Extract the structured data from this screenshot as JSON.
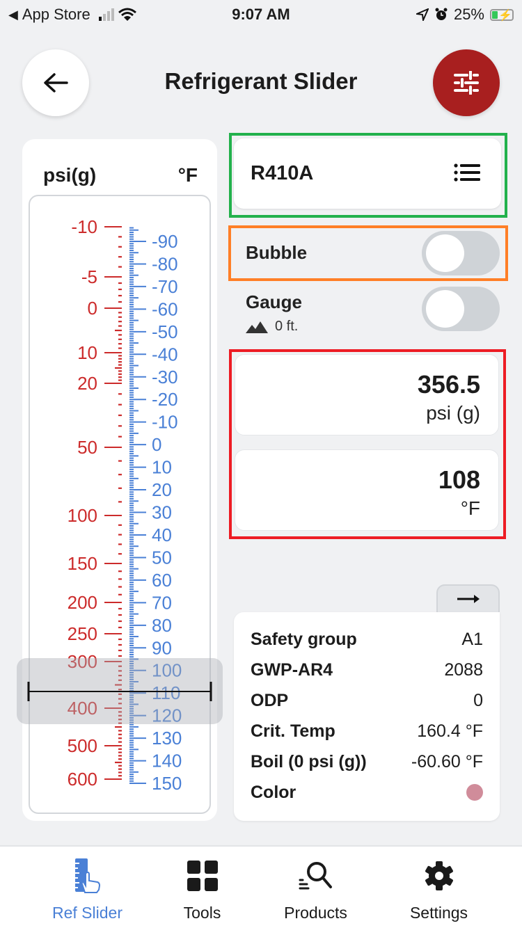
{
  "status_bar": {
    "back_app": "App Store",
    "time": "9:07 AM",
    "battery": "25%",
    "battery_level": 0.25
  },
  "header": {
    "title": "Refrigerant Slider",
    "back_icon": "arrow-left-icon",
    "filter_icon": "sliders-icon",
    "accent_color": "#a81f1f"
  },
  "scale": {
    "left_unit": "psi(g)",
    "right_unit": "°F",
    "pressure_color": "#cc2b2b",
    "temperature_color": "#4a80d6",
    "pressure_labels": [
      "-10",
      "-5",
      "0",
      "10",
      "20",
      "50",
      "100",
      "150",
      "200",
      "250",
      "300",
      "400",
      "500",
      "600"
    ],
    "temperature_labels": [
      "-90",
      "-80",
      "-70",
      "-60",
      "-50",
      "-40",
      "-30",
      "-20",
      "-10",
      "0",
      "10",
      "20",
      "30",
      "40",
      "50",
      "60",
      "70",
      "80",
      "90",
      "100",
      "110",
      "120",
      "130",
      "140",
      "150"
    ],
    "slider_temperature": 108
  },
  "refrigerant": {
    "name": "R410A",
    "list_icon": "list-icon"
  },
  "toggles": {
    "bubble_label": "Bubble",
    "bubble_on": false,
    "gauge_label": "Gauge",
    "gauge_on": false,
    "altitude": "0 ft."
  },
  "values": {
    "pressure": "356.5",
    "pressure_unit": "psi (g)",
    "temperature": "108",
    "temperature_unit": "°F"
  },
  "info": {
    "rows": [
      {
        "key": "Safety group",
        "value": "A1"
      },
      {
        "key": "GWP-AR4",
        "value": "2088"
      },
      {
        "key": "ODP",
        "value": "0"
      },
      {
        "key": "Crit. Temp",
        "value": "160.4 °F"
      },
      {
        "key": "Boil (0 psi (g))",
        "value": "-60.60 °F"
      },
      {
        "key": "Color",
        "value": ""
      }
    ],
    "color_swatch": "#d08c9a"
  },
  "nav": {
    "items": [
      {
        "label": "Ref Slider",
        "icon": "ruler-hand-icon",
        "active": true
      },
      {
        "label": "Tools",
        "icon": "grid-icon",
        "active": false
      },
      {
        "label": "Products",
        "icon": "search-list-icon",
        "active": false
      },
      {
        "label": "Settings",
        "icon": "gear-icon",
        "active": false
      }
    ],
    "active_color": "#4a80d6"
  }
}
